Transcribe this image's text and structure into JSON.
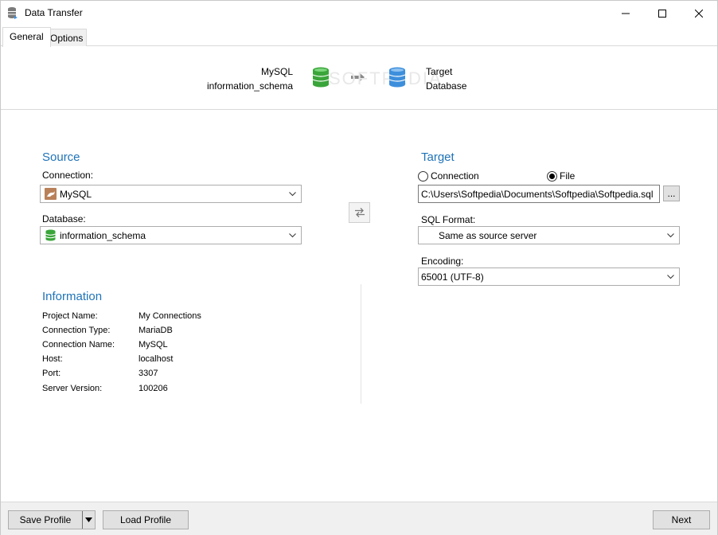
{
  "window": {
    "title": "Data Transfer"
  },
  "tabs": [
    {
      "label": "General"
    },
    {
      "label": "Options"
    }
  ],
  "banner": {
    "source_line1": "MySQL",
    "source_line2": "information_schema",
    "target_line1": "Target",
    "target_line2": "Database",
    "watermark": "SOFTPEDIA"
  },
  "source": {
    "title": "Source",
    "connection_label": "Connection:",
    "connection_value": "MySQL",
    "database_label": "Database:",
    "database_value": "information_schema"
  },
  "target": {
    "title": "Target",
    "radio_connection": "Connection",
    "radio_file": "File",
    "selected": "File",
    "file_path": "C:\\Users\\Softpedia\\Documents\\Softpedia\\Softpedia.sql",
    "browse_label": "...",
    "sql_format_label": "SQL Format:",
    "sql_format_value": "Same as source server",
    "encoding_label": "Encoding:",
    "encoding_value": "65001 (UTF-8)"
  },
  "information": {
    "title": "Information",
    "rows": [
      {
        "key": "Project Name:",
        "value": "My Connections"
      },
      {
        "key": "Connection Type:",
        "value": "MariaDB"
      },
      {
        "key": "Connection Name:",
        "value": "MySQL"
      },
      {
        "key": "Host:",
        "value": "localhost"
      },
      {
        "key": "Port:",
        "value": "3307"
      },
      {
        "key": "Server Version:",
        "value": "100206"
      }
    ]
  },
  "footer": {
    "save_profile": "Save Profile",
    "load_profile": "Load Profile",
    "next": "Next"
  },
  "colors": {
    "section_title": "#1e73b8",
    "db_green": "#3aa53a",
    "db_blue": "#3d8fdc"
  }
}
